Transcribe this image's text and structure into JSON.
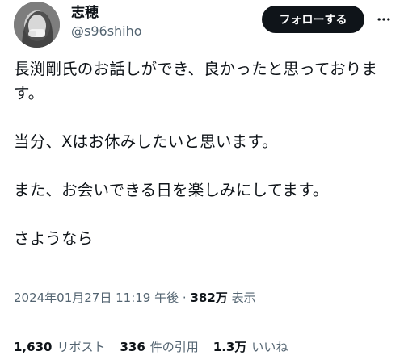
{
  "user": {
    "display_name": "志穂",
    "handle": "@s96shiho"
  },
  "actions": {
    "follow_label": "フォローする",
    "more_icon": "ellipsis-icon"
  },
  "tweet": {
    "paragraphs": [
      "長渕剛氏のお話しができ、良かったと思っております。",
      "当分、Xはお休みしたいと思います。",
      "また、お会いできる日を楽しみにしてます。",
      "さようなら"
    ]
  },
  "meta": {
    "timestamp": "2024年01月27日 11:19 午後",
    "separator": "·",
    "views_count": "382万",
    "views_label": "表示"
  },
  "stats": {
    "reposts_count": "1,630",
    "reposts_label": "リポスト",
    "quotes_count": "336",
    "quotes_label": "件の引用",
    "likes_count": "1.3万",
    "likes_label": "いいね"
  }
}
